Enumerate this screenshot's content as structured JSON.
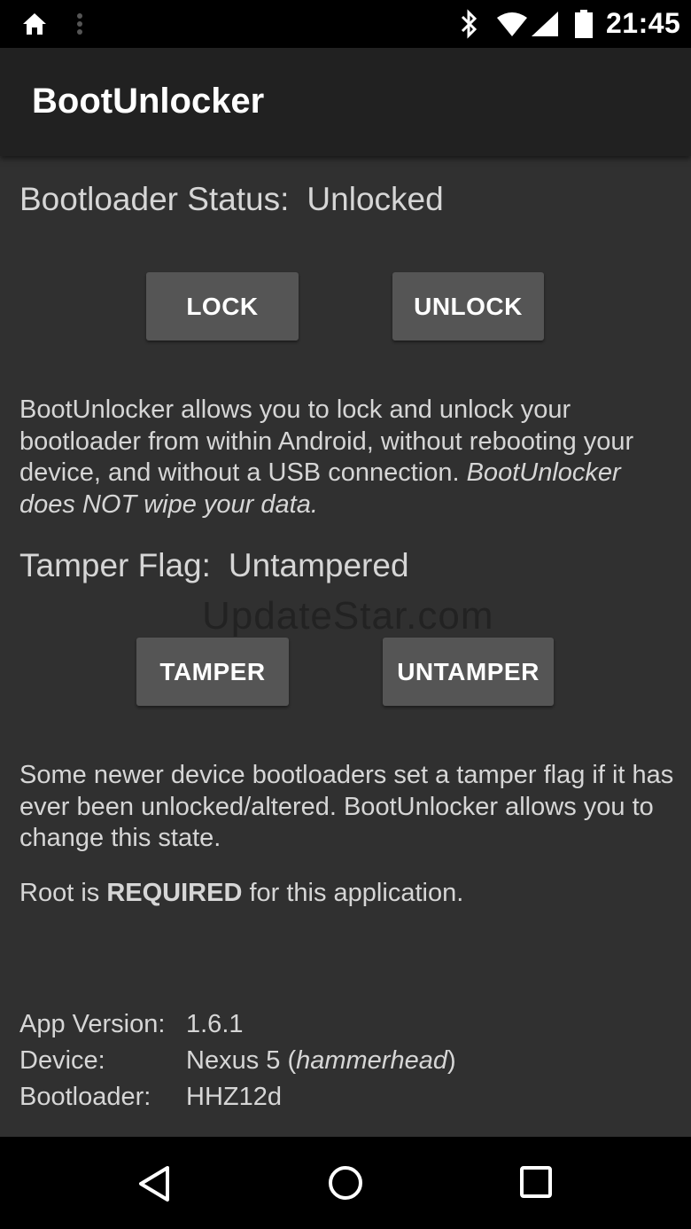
{
  "status_bar": {
    "time": "21:45"
  },
  "app_bar": {
    "title": "BootUnlocker"
  },
  "bootloader": {
    "label": "Bootloader Status:",
    "value": "Unlocked",
    "lock_button": "LOCK",
    "unlock_button": "UNLOCK",
    "description_plain": "BootUnlocker allows you to lock and unlock your bootloader from within Android, without rebooting your device, and without a USB connection. ",
    "description_italic": "BootUnlocker does NOT wipe your data."
  },
  "tamper": {
    "label": "Tamper Flag:",
    "value": "Untampered",
    "tamper_button": "TAMPER",
    "untamper_button": "UNTAMPER",
    "description": "Some newer device bootloaders set a tamper flag if it has ever been unlocked/altered. BootUnlocker allows you to change this state."
  },
  "root_notice": {
    "prefix": "Root is ",
    "emphasis": "REQUIRED",
    "suffix": " for this application."
  },
  "info": {
    "app_version_label": "App Version:",
    "app_version_value": "1.6.1",
    "device_label": "Device:",
    "device_name": "Nexus 5 (",
    "device_codename": "hammerhead",
    "device_close": ")",
    "bootloader_label": "Bootloader:",
    "bootloader_value": "HHZ12d"
  },
  "watermark": "UpdateStar.com",
  "colors": {
    "background": "#303030",
    "app_bar": "#212121",
    "button": "#555555",
    "text": "#d6d6d6"
  },
  "icons": [
    "home-icon",
    "menu-dots-icon",
    "bluetooth-icon",
    "wifi-icon",
    "signal-icon",
    "battery-icon",
    "back-icon",
    "home-circle-icon",
    "recents-icon"
  ]
}
